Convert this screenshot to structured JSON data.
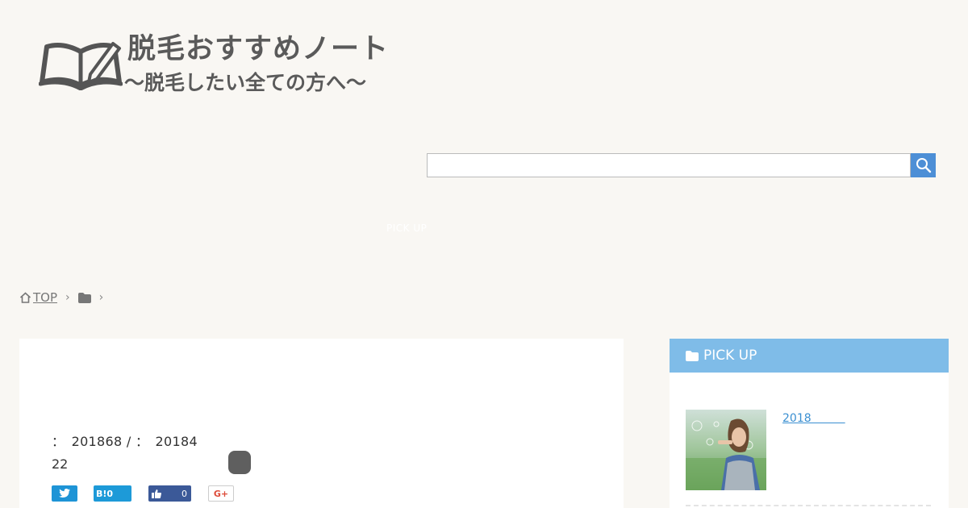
{
  "site": {
    "title_line1": "脱毛おすすめノート",
    "title_line2": "〜脱毛したい全ての方へ〜"
  },
  "search": {
    "value": "",
    "placeholder": ""
  },
  "nav": {
    "pickup_label": "PICK UP"
  },
  "breadcrumb": {
    "top_label": " TOP",
    "separator": "›"
  },
  "article": {
    "meta_line1": "：　201868 / ：　20184",
    "meta_line2": "22"
  },
  "share": {
    "hatena_label": "B!0",
    "facebook_count": "0",
    "gplus_label": "G+"
  },
  "sidebar": {
    "heading": "PICK UP",
    "items": [
      {
        "title": "2018　　　"
      }
    ]
  },
  "colors": {
    "background": "#f9f7f3",
    "search_button": "#4d8fd6",
    "sidebar_header": "#7fbce8",
    "twitter": "#1e94d6",
    "hatena": "#1d9ad8",
    "facebook": "#3b5998",
    "link": "#3a8fd1"
  },
  "icons": [
    "book-pen-logo-icon",
    "search-icon",
    "home-icon",
    "chevron-right-icon",
    "folder-icon",
    "twitter-icon",
    "facebook-like-icon"
  ]
}
